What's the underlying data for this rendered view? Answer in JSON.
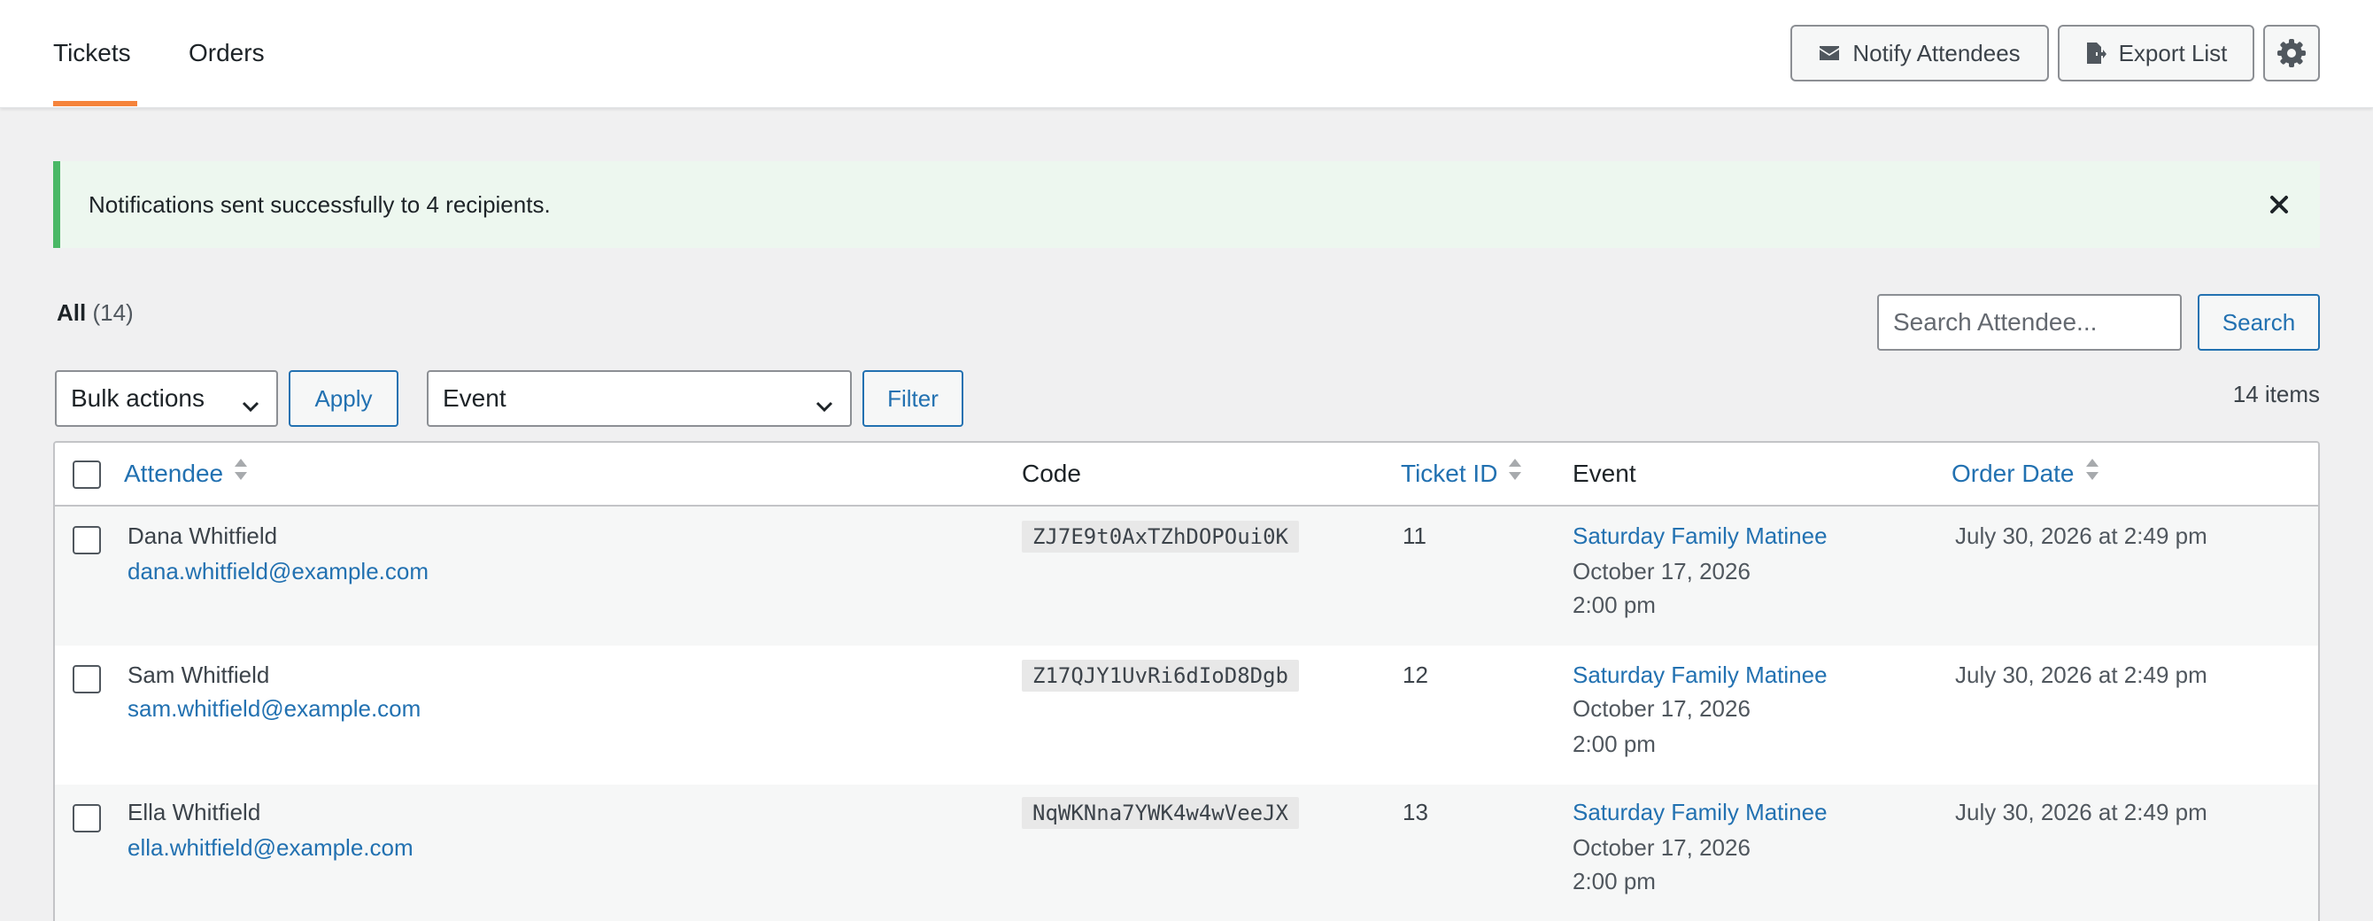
{
  "header": {
    "tabs": [
      {
        "label": "Tickets",
        "active": true
      },
      {
        "label": "Orders",
        "active": false
      }
    ],
    "buttons": {
      "notify_label": "Notify Attendees",
      "export_label": "Export List",
      "settings_icon": "gear-icon"
    },
    "accent_color": "#f5833b"
  },
  "notice": {
    "message": "Notifications sent successfully to 4 recipients.",
    "type": "success",
    "color": "#4ab866"
  },
  "views": {
    "all_label": "All",
    "all_count": "(14)"
  },
  "search": {
    "placeholder": "Search Attendee...",
    "value": "",
    "button_label": "Search"
  },
  "tablenav": {
    "bulk_actions": "Bulk actions",
    "apply_label": "Apply",
    "event_filter": "Event",
    "filter_label": "Filter",
    "items_count": "14 items"
  },
  "table": {
    "columns": {
      "attendee": "Attendee",
      "code": "Code",
      "ticket_id": "Ticket ID",
      "event": "Event",
      "order_date": "Order Date"
    },
    "rows": [
      {
        "name": "Dana Whitfield",
        "email": "dana.whitfield@example.com",
        "code": "ZJ7E9t0AxTZhDOPOui0K",
        "ticket_id": "11",
        "event_title": "Saturday Family Matinee",
        "event_date": "October 17, 2026",
        "event_time": "2:00 pm",
        "order_date": "July 30, 2026 at 2:49 pm"
      },
      {
        "name": "Sam Whitfield",
        "email": "sam.whitfield@example.com",
        "code": "Z17QJY1UvRi6dIoD8Dgb",
        "ticket_id": "12",
        "event_title": "Saturday Family Matinee",
        "event_date": "October 17, 2026",
        "event_time": "2:00 pm",
        "order_date": "July 30, 2026 at 2:49 pm"
      },
      {
        "name": "Ella Whitfield",
        "email": "ella.whitfield@example.com",
        "code": "NqWKNna7YWK4w4wVeeJX",
        "ticket_id": "13",
        "event_title": "Saturday Family Matinee",
        "event_date": "October 17, 2026",
        "event_time": "2:00 pm",
        "order_date": "July 30, 2026 at 2:49 pm"
      }
    ]
  },
  "colors": {
    "link": "#2271b1",
    "background": "#f0f0f1"
  }
}
